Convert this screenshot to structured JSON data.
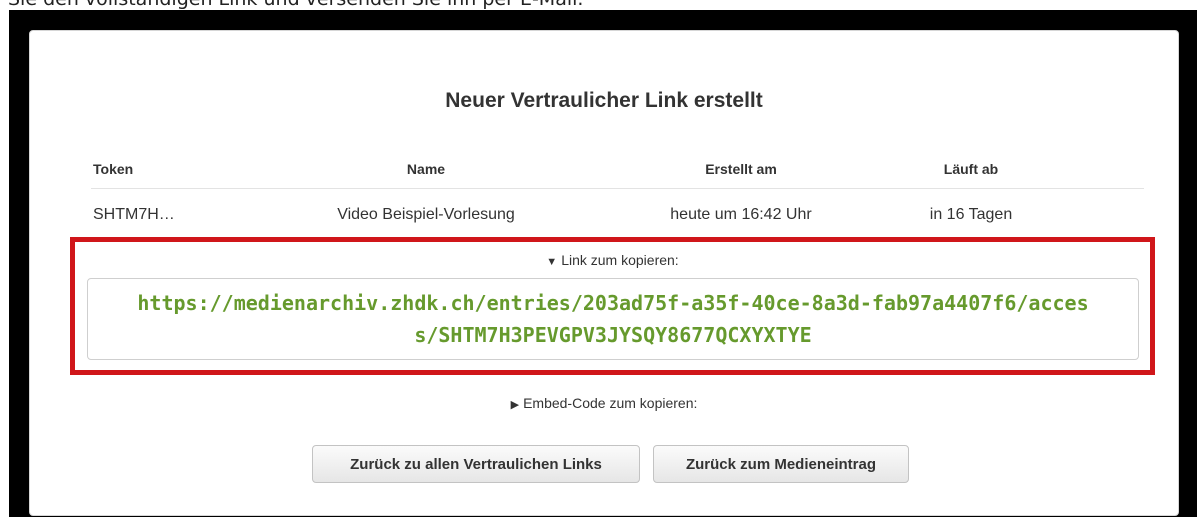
{
  "caption": "Sie den vollständigen Link und versenden Sie ihn per E-Mail.",
  "dialog": {
    "title": "Neuer Vertraulicher Link erstellt"
  },
  "table": {
    "headers": [
      "Token",
      "Name",
      "Erstellt am",
      "Läuft ab"
    ],
    "rows": [
      [
        "SHTM7H…",
        "Video Beispiel-Vorlesung",
        "heute um 16:42 Uhr",
        "in 16 Tagen"
      ]
    ]
  },
  "link_section": {
    "toggle_icon": "▼",
    "toggle_label": "Link zum kopieren:",
    "url": "https://medienarchiv.zhdk.ch/entries/203ad75f-a35f-40ce-8a3d-fab97a4407f6/access/SHTM7H3PEVGPV3JYSQY8677QCXYXTYE",
    "highlight_color": "#d0161a",
    "url_color": "#669a2d"
  },
  "embed_section": {
    "toggle_icon": "▶",
    "toggle_label": "Embed-Code zum kopieren:"
  },
  "buttons": {
    "back_all_links": "Zurück zu allen Vertraulichen Links",
    "back_media_entry": "Zurück zum Medieneintrag"
  }
}
